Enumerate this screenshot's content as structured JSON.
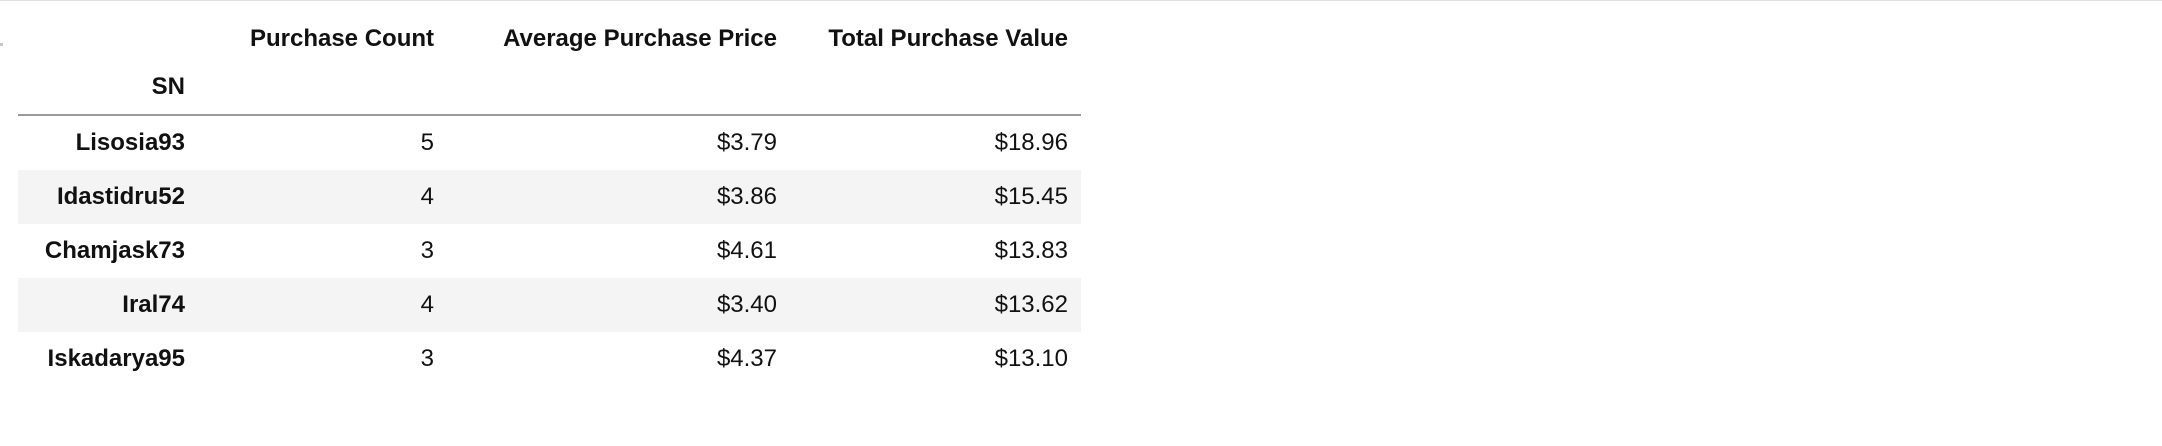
{
  "table": {
    "index_name": "SN",
    "columns": [
      "Purchase Count",
      "Average Purchase Price",
      "Total Purchase Value"
    ],
    "rows": [
      {
        "sn": "Lisosia93",
        "count": "5",
        "avg": "$3.79",
        "total": "$18.96"
      },
      {
        "sn": "Idastidru52",
        "count": "4",
        "avg": "$3.86",
        "total": "$15.45"
      },
      {
        "sn": "Chamjask73",
        "count": "3",
        "avg": "$4.61",
        "total": "$13.83"
      },
      {
        "sn": "Iral74",
        "count": "4",
        "avg": "$3.40",
        "total": "$13.62"
      },
      {
        "sn": "Iskadarya95",
        "count": "3",
        "avg": "$4.37",
        "total": "$13.10"
      }
    ]
  }
}
